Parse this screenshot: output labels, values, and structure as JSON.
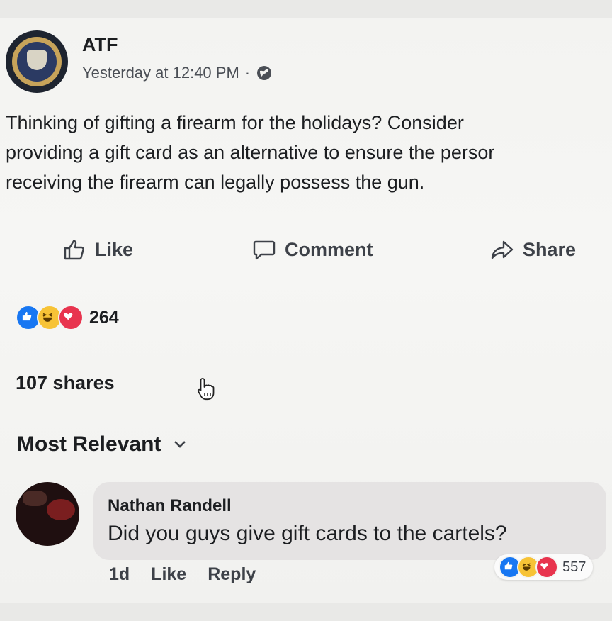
{
  "post": {
    "author": "ATF",
    "timestamp": "Yesterday at 12:40 PM",
    "separator": "·",
    "privacy_icon": "globe-icon",
    "text_lines": [
      "Thinking of gifting a firearm for the holidays? Consider",
      "providing a gift card as an alternative to ensure the persor",
      "receiving the firearm can legally possess the gun."
    ]
  },
  "actions": {
    "like": "Like",
    "comment": "Comment",
    "share": "Share"
  },
  "reactions": {
    "types": [
      "like-icon",
      "haha-icon",
      "love-icon"
    ],
    "count": "264"
  },
  "shares": "107 shares",
  "comments_sort": "Most Relevant",
  "comment": {
    "author": "Nathan Randell",
    "text": "Did you guys give gift cards to the cartels?",
    "age": "1d",
    "like": "Like",
    "reply": "Reply",
    "reaction_count": "557"
  },
  "colors": {
    "like": "#1877f2",
    "haha": "#f7c336",
    "love": "#e8344e"
  }
}
